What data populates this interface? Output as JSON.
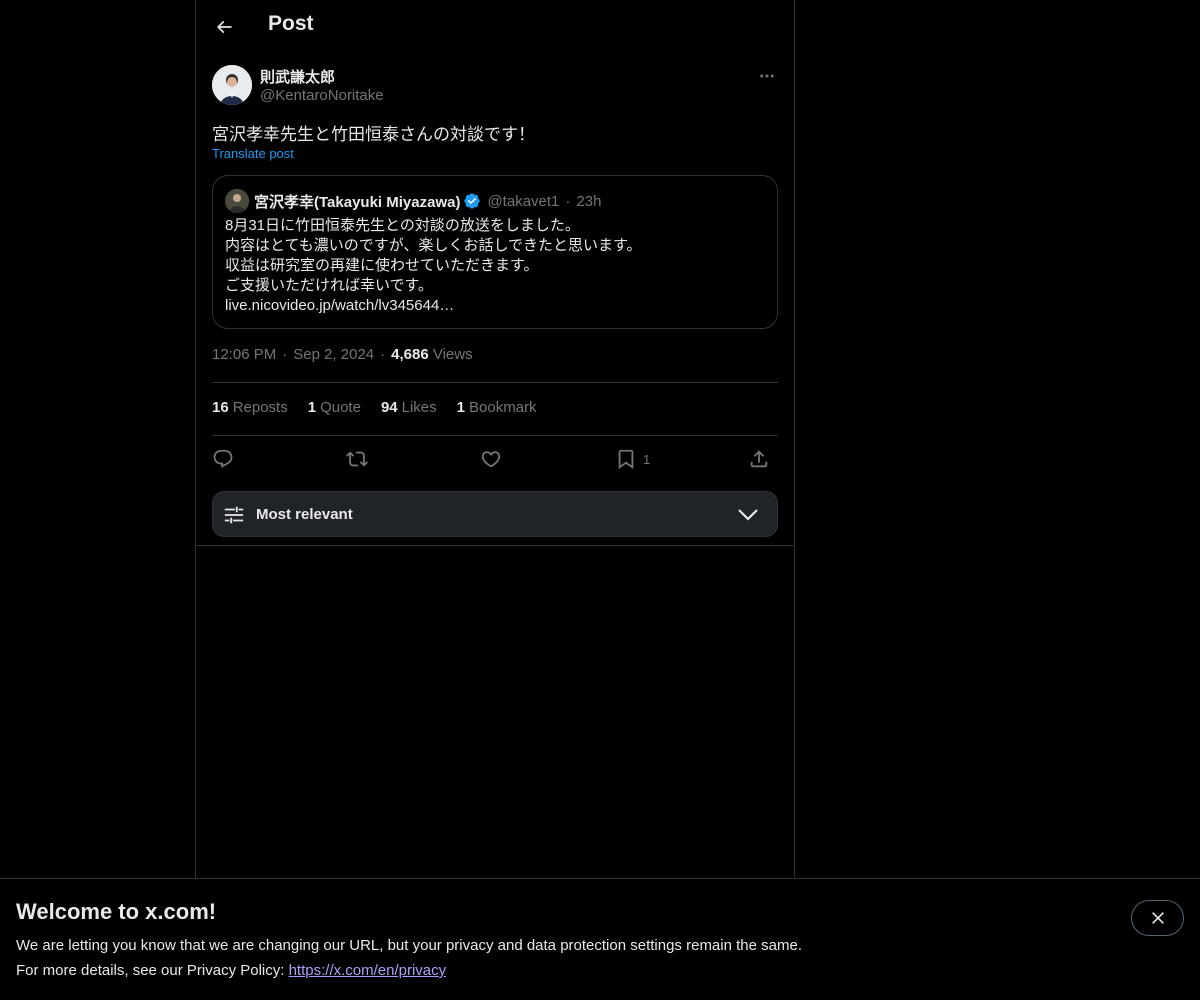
{
  "header": {
    "title": "Post"
  },
  "post": {
    "author_name": "則武謙太郎",
    "author_handle": "@KentaroNoritake",
    "text": "宮沢孝幸先生と竹田恒泰さんの対談です！",
    "translate_label": "Translate post",
    "time": "12:06 PM",
    "date": "Sep 2, 2024",
    "views_count": "4,686",
    "views_label": "Views"
  },
  "quote": {
    "name": "宮沢孝幸(Takayuki Miyazawa)",
    "handle": "@takavet1",
    "dot": "·",
    "time": "23h",
    "lines": [
      "8月31日に竹田恒泰先生との対談の放送をしました。",
      "内容はとても濃いのですが、楽しくお話しできたと思います。",
      "収益は研究室の再建に使わせていただきます。",
      "ご支援いただければ幸いです。",
      "live.nicovideo.jp/watch/lv345644…"
    ]
  },
  "stats": {
    "reposts_count": "16",
    "reposts_label": "Reposts",
    "quote_count": "1",
    "quote_label": "Quote",
    "likes_count": "94",
    "likes_label": "Likes",
    "bookmark_count": "1",
    "bookmark_label": "Bookmark"
  },
  "actions": {
    "bookmark_count": "1"
  },
  "sort": {
    "label": "Most relevant"
  },
  "banner": {
    "title": "Welcome to x.com!",
    "line1": "We are letting you know that we are changing our URL, but your privacy and data protection settings remain the same.",
    "line2_prefix": "For more details, see our Privacy Policy: ",
    "link": "https://x.com/en/privacy"
  },
  "colors": {
    "accent": "#1d9bf0",
    "link_visited": "#a7a2f9",
    "muted": "#71767b",
    "border": "#2f3336"
  },
  "icons": [
    "back-arrow-icon",
    "more-icon",
    "verified-icon",
    "reply-icon",
    "repost-icon",
    "like-icon",
    "bookmark-icon",
    "share-icon",
    "sliders-icon",
    "chevron-down-icon",
    "close-icon"
  ]
}
